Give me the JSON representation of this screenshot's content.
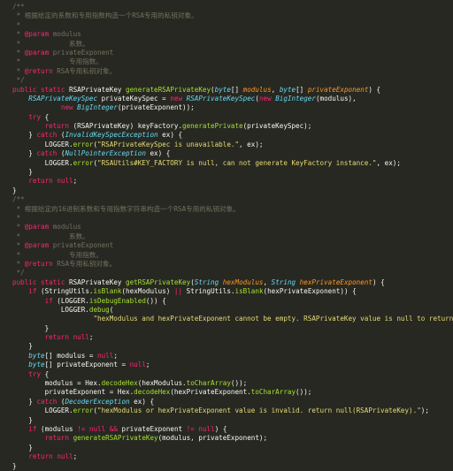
{
  "editor": {
    "theme": {
      "background": "#272822",
      "plain": "#f8f8f2",
      "comment": "#75715e",
      "keyword": "#f92672",
      "type": "#66d9ef",
      "function": "#a6e22e",
      "string": "#e6db74",
      "param": "#fd971f",
      "annotation": "#f92672"
    },
    "lines": [
      [
        [
          "cm",
          "/**"
        ]
      ],
      [
        [
          "cm",
          " * 根据给定的系数和专用指数构造一个RSA专用的私钥对象。"
        ]
      ],
      [
        [
          "cm",
          " *"
        ]
      ],
      [
        [
          "cm",
          " * "
        ],
        [
          "at",
          "@param"
        ],
        [
          "cm",
          " modulus"
        ]
      ],
      [
        [
          "cm",
          " *            系数。"
        ]
      ],
      [
        [
          "cm",
          " * "
        ],
        [
          "at",
          "@param"
        ],
        [
          "cm",
          " privateExponent"
        ]
      ],
      [
        [
          "cm",
          " *            专用指数。"
        ]
      ],
      [
        [
          "cm",
          " * "
        ],
        [
          "at",
          "@return"
        ],
        [
          "cm",
          " RSA专用私钥对象。"
        ]
      ],
      [
        [
          "cm",
          " */"
        ]
      ],
      [
        [
          "kw",
          "public"
        ],
        [
          "pl",
          " "
        ],
        [
          "kw",
          "static"
        ],
        [
          "pl",
          " RSAPrivateKey "
        ],
        [
          "fn",
          "generateRSAPrivateKey"
        ],
        [
          "pl",
          "("
        ],
        [
          "ty",
          "byte"
        ],
        [
          "pl",
          "[] "
        ],
        [
          "pa",
          "modulus"
        ],
        [
          "pl",
          ", "
        ],
        [
          "ty",
          "byte"
        ],
        [
          "pl",
          "[] "
        ],
        [
          "pa",
          "privateExponent"
        ],
        [
          "pl",
          ") {"
        ]
      ],
      [
        [
          "pl",
          "    "
        ],
        [
          "ty",
          "RSAPrivateKeySpec"
        ],
        [
          "pl",
          " privateKeySpec = "
        ],
        [
          "kw",
          "new"
        ],
        [
          "pl",
          " "
        ],
        [
          "ty",
          "RSAPrivateKeySpec"
        ],
        [
          "pl",
          "("
        ],
        [
          "kw",
          "new"
        ],
        [
          "pl",
          " "
        ],
        [
          "ty",
          "BigInteger"
        ],
        [
          "pl",
          "(modulus),"
        ]
      ],
      [
        [
          "pl",
          "            "
        ],
        [
          "kw",
          "new"
        ],
        [
          "pl",
          " "
        ],
        [
          "ty",
          "BigInteger"
        ],
        [
          "pl",
          "(privateExponent));"
        ]
      ],
      [
        [
          "pl",
          "    "
        ],
        [
          "kw",
          "try"
        ],
        [
          "pl",
          " {"
        ]
      ],
      [
        [
          "pl",
          "        "
        ],
        [
          "kw",
          "return"
        ],
        [
          "pl",
          " (RSAPrivateKey) keyFactory."
        ],
        [
          "fn",
          "generatePrivate"
        ],
        [
          "pl",
          "(privateKeySpec);"
        ]
      ],
      [
        [
          "pl",
          "    } "
        ],
        [
          "kw",
          "catch"
        ],
        [
          "pl",
          " ("
        ],
        [
          "ty",
          "InvalidKeySpecException"
        ],
        [
          "pl",
          " ex) {"
        ]
      ],
      [
        [
          "pl",
          "        LOGGER."
        ],
        [
          "fn",
          "error"
        ],
        [
          "pl",
          "("
        ],
        [
          "st",
          "\"RSAPrivateKeySpec is unavailable.\""
        ],
        [
          "pl",
          ", ex);"
        ]
      ],
      [
        [
          "pl",
          "    } "
        ],
        [
          "kw",
          "catch"
        ],
        [
          "pl",
          " ("
        ],
        [
          "ty",
          "NullPointerException"
        ],
        [
          "pl",
          " ex) {"
        ]
      ],
      [
        [
          "pl",
          "        LOGGER."
        ],
        [
          "fn",
          "error"
        ],
        [
          "pl",
          "("
        ],
        [
          "st",
          "\"RSAUtils#KEY_FACTORY is null, can not generate KeyFactory instance.\""
        ],
        [
          "pl",
          ", ex);"
        ]
      ],
      [
        [
          "pl",
          "    }"
        ]
      ],
      [
        [
          "pl",
          "    "
        ],
        [
          "kw",
          "return"
        ],
        [
          "pl",
          " "
        ],
        [
          "kw",
          "null"
        ],
        [
          "pl",
          ";"
        ]
      ],
      [
        [
          "pl",
          "}"
        ]
      ],
      [
        [
          "cm",
          "/**"
        ]
      ],
      [
        [
          "cm",
          " * 根据给定的16进制系数和专用指数字符串构造一个RSA专用的私钥对象。"
        ]
      ],
      [
        [
          "cm",
          " *"
        ]
      ],
      [
        [
          "cm",
          " * "
        ],
        [
          "at",
          "@param"
        ],
        [
          "cm",
          " modulus"
        ]
      ],
      [
        [
          "cm",
          " *            系数。"
        ]
      ],
      [
        [
          "cm",
          " * "
        ],
        [
          "at",
          "@param"
        ],
        [
          "cm",
          " privateExponent"
        ]
      ],
      [
        [
          "cm",
          " *            专用指数。"
        ]
      ],
      [
        [
          "cm",
          " * "
        ],
        [
          "at",
          "@return"
        ],
        [
          "cm",
          " RSA专用私钥对象。"
        ]
      ],
      [
        [
          "cm",
          " */"
        ]
      ],
      [
        [
          "kw",
          "public"
        ],
        [
          "pl",
          " "
        ],
        [
          "kw",
          "static"
        ],
        [
          "pl",
          " RSAPrivateKey "
        ],
        [
          "fn",
          "getRSAPrivateKey"
        ],
        [
          "pl",
          "("
        ],
        [
          "ty",
          "String"
        ],
        [
          "pl",
          " "
        ],
        [
          "pa",
          "hexModulus"
        ],
        [
          "pl",
          ", "
        ],
        [
          "ty",
          "String"
        ],
        [
          "pl",
          " "
        ],
        [
          "pa",
          "hexPrivateExponent"
        ],
        [
          "pl",
          ") {"
        ]
      ],
      [
        [
          "pl",
          "    "
        ],
        [
          "kw",
          "if"
        ],
        [
          "pl",
          " (StringUtils."
        ],
        [
          "fn",
          "isBlank"
        ],
        [
          "pl",
          "(hexModulus) "
        ],
        [
          "kw",
          "||"
        ],
        [
          "pl",
          " StringUtils."
        ],
        [
          "fn",
          "isBlank"
        ],
        [
          "pl",
          "(hexPrivateExponent)) {"
        ]
      ],
      [
        [
          "pl",
          "        "
        ],
        [
          "kw",
          "if"
        ],
        [
          "pl",
          " (LOGGER."
        ],
        [
          "fn",
          "isDebugEnabled"
        ],
        [
          "pl",
          "()) {"
        ]
      ],
      [
        [
          "pl",
          "            LOGGER."
        ],
        [
          "fn",
          "debug"
        ],
        [
          "pl",
          "("
        ]
      ],
      [
        [
          "pl",
          "                    "
        ],
        [
          "st",
          "\"hexModulus and hexPrivateExponent cannot be empty. RSAPrivateKey value is null to return.\""
        ],
        [
          "pl",
          ");"
        ]
      ],
      [
        [
          "pl",
          "        }"
        ]
      ],
      [
        [
          "pl",
          "        "
        ],
        [
          "kw",
          "return"
        ],
        [
          "pl",
          " "
        ],
        [
          "kw",
          "null"
        ],
        [
          "pl",
          ";"
        ]
      ],
      [
        [
          "pl",
          "    }"
        ]
      ],
      [
        [
          "pl",
          "    "
        ],
        [
          "ty",
          "byte"
        ],
        [
          "pl",
          "[] modulus = "
        ],
        [
          "kw",
          "null"
        ],
        [
          "pl",
          ";"
        ]
      ],
      [
        [
          "pl",
          "    "
        ],
        [
          "ty",
          "byte"
        ],
        [
          "pl",
          "[] privateExponent = "
        ],
        [
          "kw",
          "null"
        ],
        [
          "pl",
          ";"
        ]
      ],
      [
        [
          "pl",
          "    "
        ],
        [
          "kw",
          "try"
        ],
        [
          "pl",
          " {"
        ]
      ],
      [
        [
          "pl",
          "        modulus = Hex."
        ],
        [
          "fn",
          "decodeHex"
        ],
        [
          "pl",
          "(hexModulus."
        ],
        [
          "fn",
          "toCharArray"
        ],
        [
          "pl",
          "());"
        ]
      ],
      [
        [
          "pl",
          "        privateExponent = Hex."
        ],
        [
          "fn",
          "decodeHex"
        ],
        [
          "pl",
          "(hexPrivateExponent."
        ],
        [
          "fn",
          "toCharArray"
        ],
        [
          "pl",
          "());"
        ]
      ],
      [
        [
          "pl",
          "    } "
        ],
        [
          "kw",
          "catch"
        ],
        [
          "pl",
          " ("
        ],
        [
          "ty",
          "DecoderException"
        ],
        [
          "pl",
          " ex) {"
        ]
      ],
      [
        [
          "pl",
          "        LOGGER."
        ],
        [
          "fn",
          "error"
        ],
        [
          "pl",
          "("
        ],
        [
          "st",
          "\"hexModulus or hexPrivateExponent value is invalid. return null(RSAPrivateKey).\""
        ],
        [
          "pl",
          ");"
        ]
      ],
      [
        [
          "pl",
          "    }"
        ]
      ],
      [
        [
          "pl",
          "    "
        ],
        [
          "kw",
          "if"
        ],
        [
          "pl",
          " (modulus "
        ],
        [
          "kw",
          "!="
        ],
        [
          "pl",
          " "
        ],
        [
          "kw",
          "null"
        ],
        [
          "pl",
          " "
        ],
        [
          "kw",
          "&&"
        ],
        [
          "pl",
          " privateExponent "
        ],
        [
          "kw",
          "!="
        ],
        [
          "pl",
          " "
        ],
        [
          "kw",
          "null"
        ],
        [
          "pl",
          ") {"
        ]
      ],
      [
        [
          "pl",
          "        "
        ],
        [
          "kw",
          "return"
        ],
        [
          "pl",
          " "
        ],
        [
          "fn",
          "generateRSAPrivateKey"
        ],
        [
          "pl",
          "(modulus, privateExponent);"
        ]
      ],
      [
        [
          "pl",
          "    }"
        ]
      ],
      [
        [
          "pl",
          "    "
        ],
        [
          "kw",
          "return"
        ],
        [
          "pl",
          " "
        ],
        [
          "kw",
          "null"
        ],
        [
          "pl",
          ";"
        ]
      ],
      [
        [
          "pl",
          "}"
        ]
      ]
    ]
  }
}
